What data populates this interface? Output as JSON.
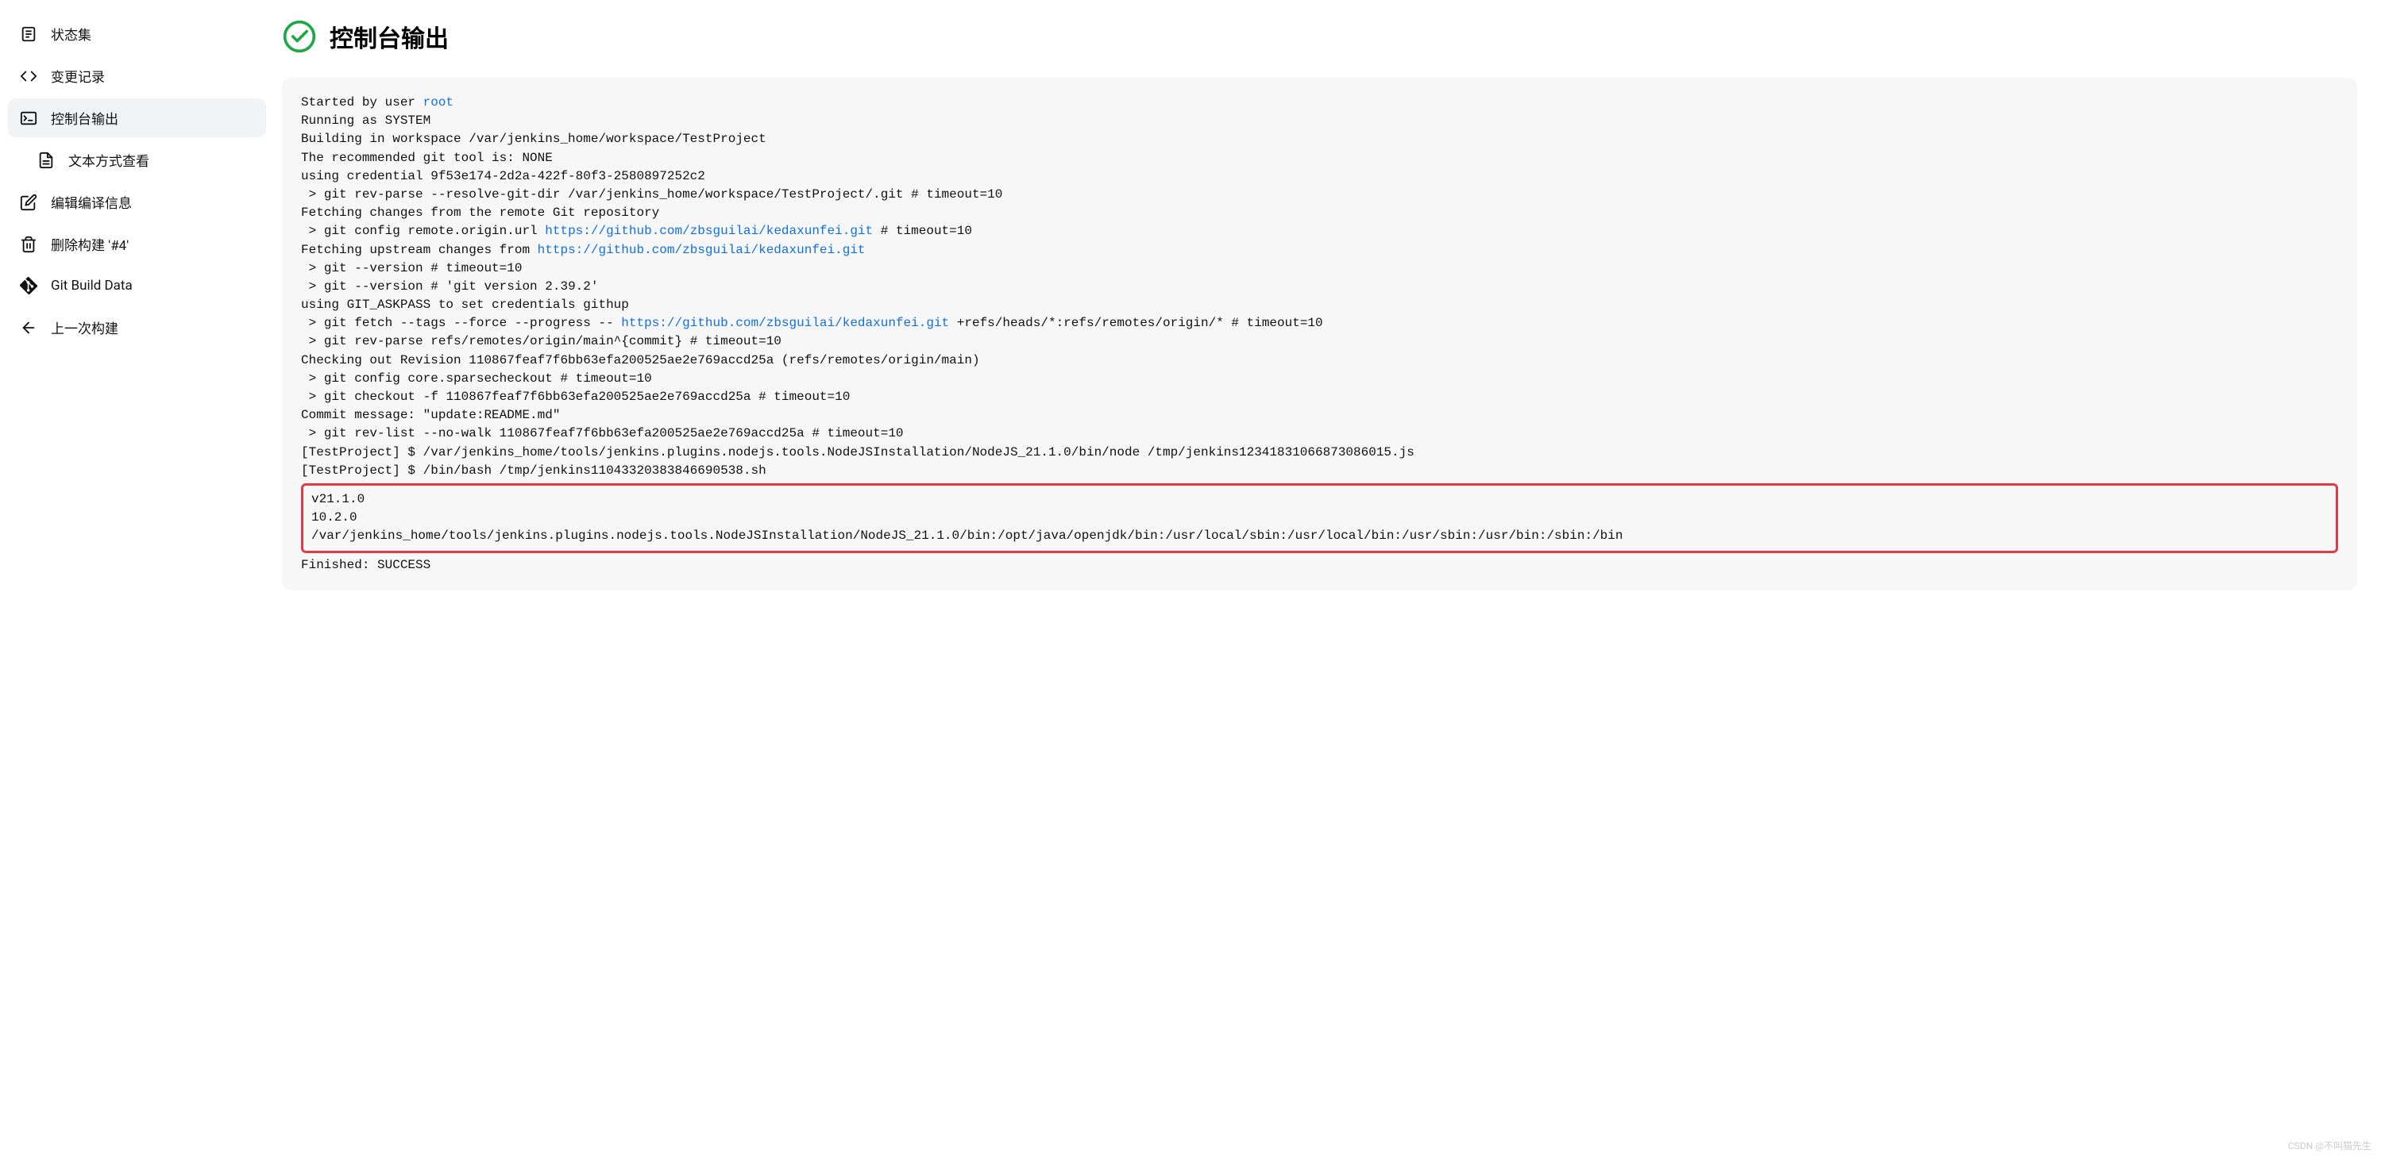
{
  "sidebar": {
    "items": [
      {
        "label": "状态集",
        "icon": "document-list-icon"
      },
      {
        "label": "变更记录",
        "icon": "code-icon"
      },
      {
        "label": "控制台输出",
        "icon": "terminal-icon",
        "active": true
      },
      {
        "label": "文本方式查看",
        "icon": "file-icon",
        "sub": true
      },
      {
        "label": "编辑编译信息",
        "icon": "edit-icon"
      },
      {
        "label": "删除构建 '#4'",
        "icon": "trash-icon"
      },
      {
        "label": "Git Build Data",
        "icon": "git-icon"
      },
      {
        "label": "上一次构建",
        "icon": "arrow-left-icon"
      }
    ]
  },
  "header": {
    "title": "控制台输出",
    "status_icon": "success-check-icon"
  },
  "console": {
    "line1_prefix": "Started by user ",
    "line1_link": "root",
    "line2": "Running as SYSTEM",
    "line3": "Building in workspace /var/jenkins_home/workspace/TestProject",
    "line4": "The recommended git tool is: NONE",
    "line5": "using credential 9f53e174-2d2a-422f-80f3-2580897252c2",
    "line6": " > git rev-parse --resolve-git-dir /var/jenkins_home/workspace/TestProject/.git # timeout=10",
    "line7": "Fetching changes from the remote Git repository",
    "line8_prefix": " > git config remote.origin.url ",
    "line8_link": "https://github.com/zbsguilai/kedaxunfei.git",
    "line8_suffix": " # timeout=10",
    "line9_prefix": "Fetching upstream changes from ",
    "line9_link": "https://github.com/zbsguilai/kedaxunfei.git",
    "line10": " > git --version # timeout=10",
    "line11": " > git --version # 'git version 2.39.2'",
    "line12": "using GIT_ASKPASS to set credentials githup",
    "line13_prefix": " > git fetch --tags --force --progress -- ",
    "line13_link": "https://github.com/zbsguilai/kedaxunfei.git",
    "line13_suffix": " +refs/heads/*:refs/remotes/origin/* # timeout=10",
    "line14": " > git rev-parse refs/remotes/origin/main^{commit} # timeout=10",
    "line15": "Checking out Revision 110867feaf7f6bb63efa200525ae2e769accd25a (refs/remotes/origin/main)",
    "line16": " > git config core.sparsecheckout # timeout=10",
    "line17": " > git checkout -f 110867feaf7f6bb63efa200525ae2e769accd25a # timeout=10",
    "line18": "Commit message: \"update:README.md\"",
    "line19": " > git rev-list --no-walk 110867feaf7f6bb63efa200525ae2e769accd25a # timeout=10",
    "line20": "[TestProject] $ /var/jenkins_home/tools/jenkins.plugins.nodejs.tools.NodeJSInstallation/NodeJS_21.1.0/bin/node /tmp/jenkins12341831066873086015.js",
    "line21": "[TestProject] $ /bin/bash /tmp/jenkins11043320383846690538.sh",
    "highlighted": "v21.1.0\n10.2.0\n/var/jenkins_home/tools/jenkins.plugins.nodejs.tools.NodeJSInstallation/NodeJS_21.1.0/bin:/opt/java/openjdk/bin:/usr/local/sbin:/usr/local/bin:/usr/sbin:/usr/bin:/sbin:/bin",
    "line_final": "Finished: SUCCESS"
  },
  "watermark": "CSDN @不叫猫先生"
}
